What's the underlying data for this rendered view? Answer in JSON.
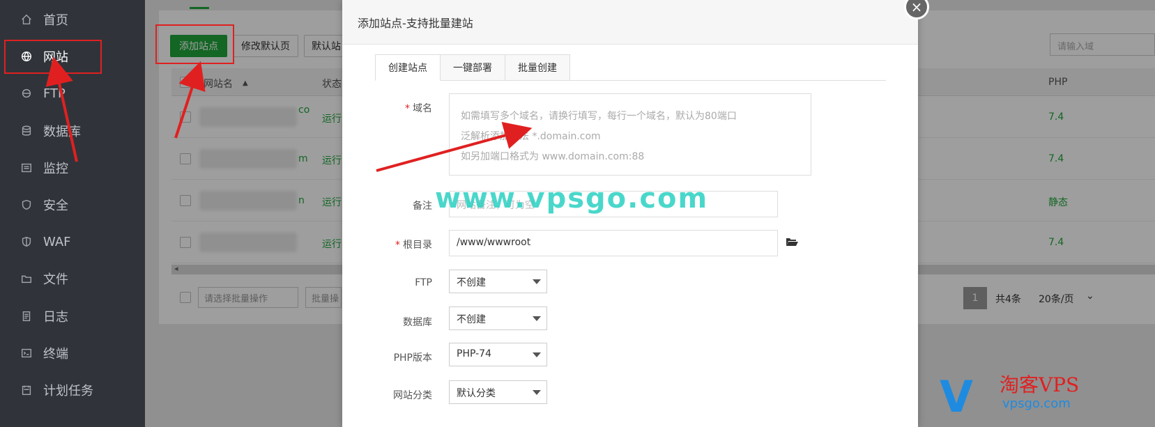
{
  "sidebar": {
    "items": [
      {
        "label": "首页",
        "icon": "home-icon"
      },
      {
        "label": "网站",
        "icon": "globe-icon"
      },
      {
        "label": "FTP",
        "icon": "ftp-icon"
      },
      {
        "label": "数据库",
        "icon": "database-icon"
      },
      {
        "label": "监控",
        "icon": "monitor-icon"
      },
      {
        "label": "安全",
        "icon": "shield-icon"
      },
      {
        "label": "WAF",
        "icon": "waf-icon"
      },
      {
        "label": "文件",
        "icon": "folder-icon"
      },
      {
        "label": "日志",
        "icon": "log-icon"
      },
      {
        "label": "终端",
        "icon": "terminal-icon"
      },
      {
        "label": "计划任务",
        "icon": "schedule-icon"
      }
    ],
    "active": "网站"
  },
  "toolbar": {
    "add_site": "添加站点",
    "modify_default": "修改默认页",
    "default_site": "默认站",
    "search_placeholder": "请输入域"
  },
  "table": {
    "headers": {
      "name": "网站名",
      "status": "状态",
      "php": "PHP"
    },
    "rows": [
      {
        "name_tail": "co",
        "status": "运行",
        "php": "7.4"
      },
      {
        "name_tail": "m",
        "status": "运行",
        "php": "7.4"
      },
      {
        "name_tail": "n",
        "status": "运行",
        "php": "静态"
      },
      {
        "name_tail": "",
        "status": "运行",
        "php": "7.4"
      }
    ],
    "scroll_left_glyph": "◂"
  },
  "footer": {
    "bulk_select": "请选择批量操作",
    "bulk_button": "批量操",
    "page": "1",
    "total": "共4条",
    "per_page": "20条/页"
  },
  "dialog": {
    "title": "添加站点-支持批量建站",
    "close": "×",
    "tabs": [
      "创建站点",
      "一键部署",
      "批量创建"
    ],
    "fields": {
      "domain_label": "域名",
      "domain_hints": [
        "如需填写多个域名，请换行填写，每行一个域名，默认为80端口",
        "泛解析添加方法 *.domain.com",
        "如另加端口格式为 www.domain.com:88"
      ],
      "remark_label": "备注",
      "remark_placeholder": "网站备注，可为空",
      "root_label": "根目录",
      "root_value": "/www/wwwroot",
      "ftp_label": "FTP",
      "ftp_value": "不创建",
      "db_label": "数据库",
      "db_value": "不创建",
      "php_label": "PHP版本",
      "php_value": "PHP-74",
      "category_label": "网站分类",
      "category_value": "默认分类",
      "required_mark": "*"
    }
  },
  "watermark": "www.vpsgo.com",
  "logo": {
    "letter": "V",
    "cn": "淘客VPS",
    "url": "vpsgo.com"
  },
  "colors": {
    "accent": "#20a53a",
    "annotation": "#e02020",
    "sidebar": "#30343a"
  }
}
